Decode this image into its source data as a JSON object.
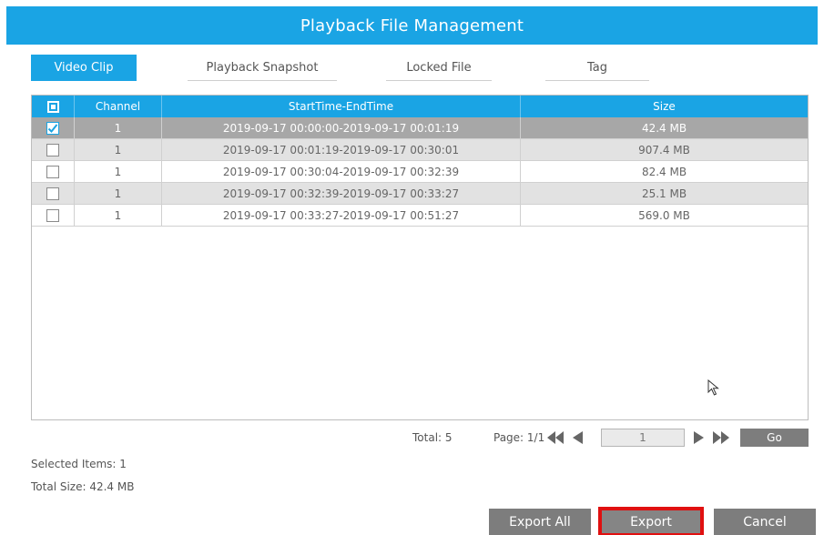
{
  "title": "Playback File Management",
  "tabs": [
    {
      "label": "Video Clip",
      "active": true
    },
    {
      "label": "Playback Snapshot",
      "active": false
    },
    {
      "label": "Locked File",
      "active": false
    },
    {
      "label": "Tag",
      "active": false
    }
  ],
  "table": {
    "headers": {
      "channel": "Channel",
      "time": "StartTime-EndTime",
      "size": "Size"
    },
    "rows": [
      {
        "checked": true,
        "channel": "1",
        "time": "2019-09-17 00:00:00-2019-09-17 00:01:19",
        "size": "42.4 MB"
      },
      {
        "checked": false,
        "channel": "1",
        "time": "2019-09-17 00:01:19-2019-09-17 00:30:01",
        "size": "907.4 MB"
      },
      {
        "checked": false,
        "channel": "1",
        "time": "2019-09-17 00:30:04-2019-09-17 00:32:39",
        "size": "82.4 MB"
      },
      {
        "checked": false,
        "channel": "1",
        "time": "2019-09-17 00:32:39-2019-09-17 00:33:27",
        "size": "25.1 MB"
      },
      {
        "checked": false,
        "channel": "1",
        "time": "2019-09-17 00:33:27-2019-09-17 00:51:27",
        "size": "569.0 MB"
      }
    ]
  },
  "pagination": {
    "total": "Total: 5",
    "page": "Page: 1/1",
    "page_input": "1",
    "go_label": "Go"
  },
  "summary": {
    "selected_items": "Selected Items: 1",
    "total_size": "Total Size: 42.4 MB"
  },
  "buttons": {
    "export_all": "Export All",
    "export": "Export",
    "cancel": "Cancel"
  },
  "colors": {
    "accent": "#1aa4e4",
    "selected_row": "#a7a7a7",
    "button_gray": "#7d7d7d",
    "highlight_red": "#e01010"
  }
}
